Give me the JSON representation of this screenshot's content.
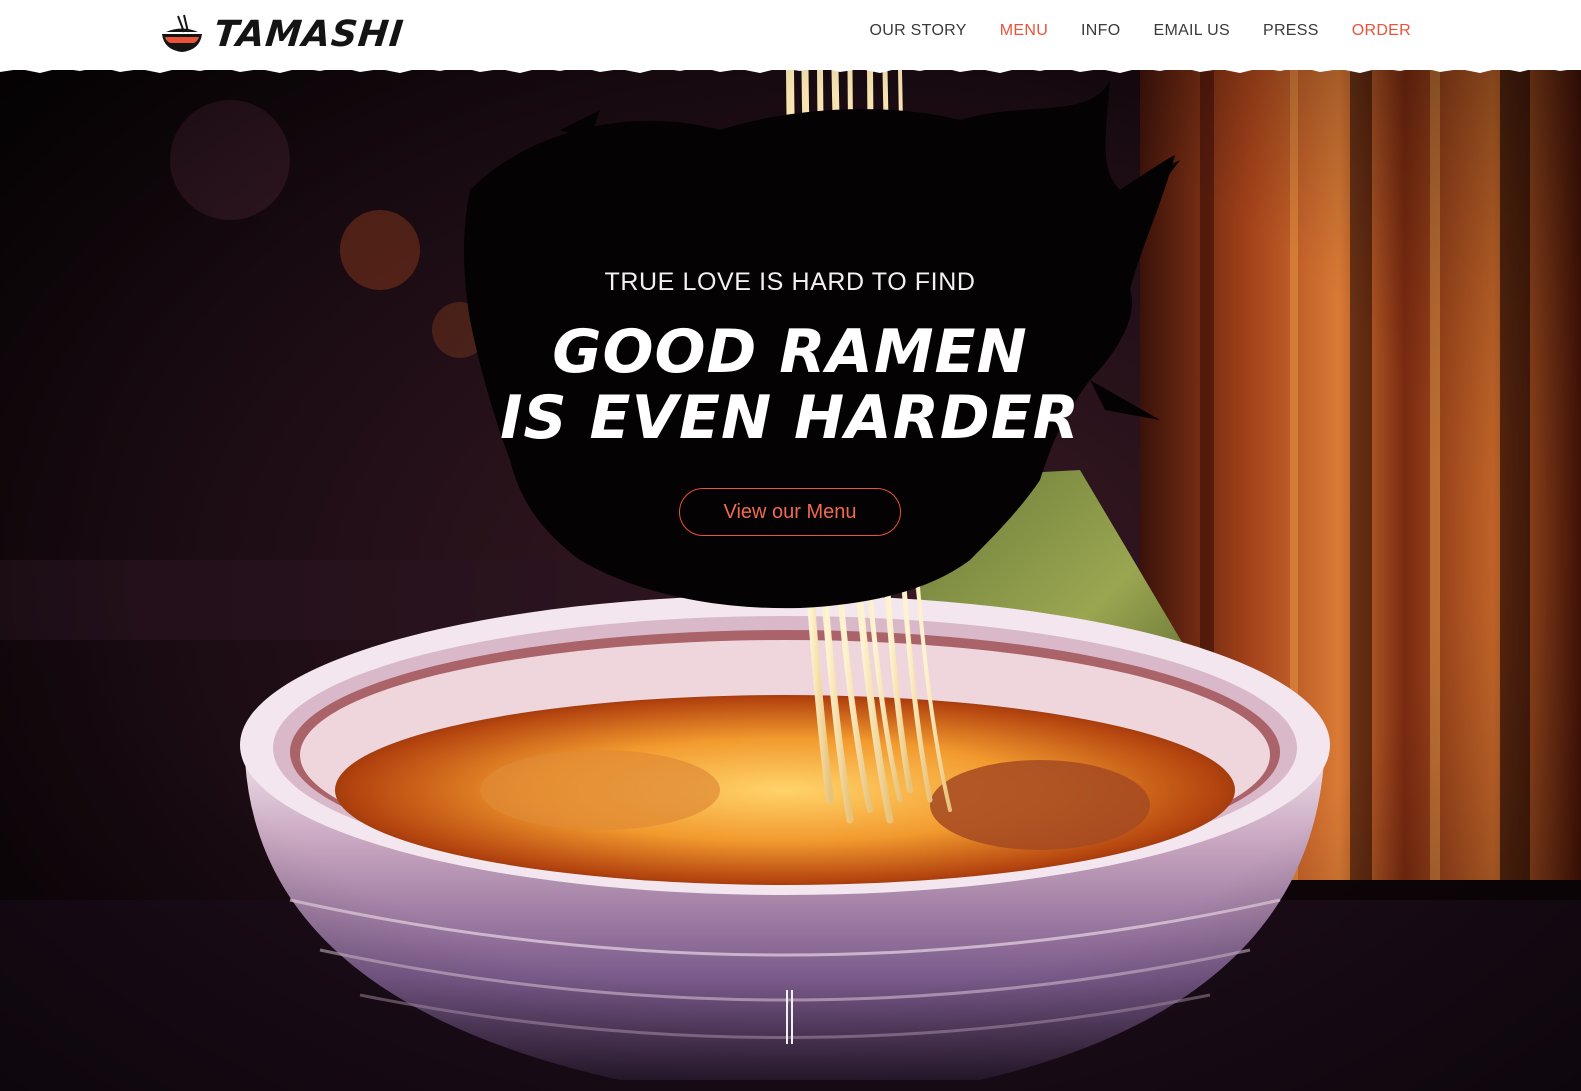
{
  "brand": {
    "name": "TAMASHI",
    "logo_icon": "ramen-bowl-icon"
  },
  "nav": {
    "items": [
      {
        "label": "OUR STORY"
      },
      {
        "label": "MENU"
      },
      {
        "label": "INFO"
      },
      {
        "label": "EMAIL US"
      },
      {
        "label": "PRESS"
      },
      {
        "label": "ORDER"
      }
    ],
    "accent_items": [
      "MENU",
      "ORDER"
    ]
  },
  "hero": {
    "tagline": "TRUE LOVE IS HARD TO FIND",
    "headline_line1": "GOOD RAMEN",
    "headline_line2": "IS EVEN HARDER",
    "cta_label": "View our Menu",
    "scroll_icon": "scroll-down-icon"
  },
  "colors": {
    "accent": "#e9533a",
    "header_bg": "#ffffff",
    "nav_text": "#3a3a3a",
    "hero_text": "#ffffff"
  }
}
